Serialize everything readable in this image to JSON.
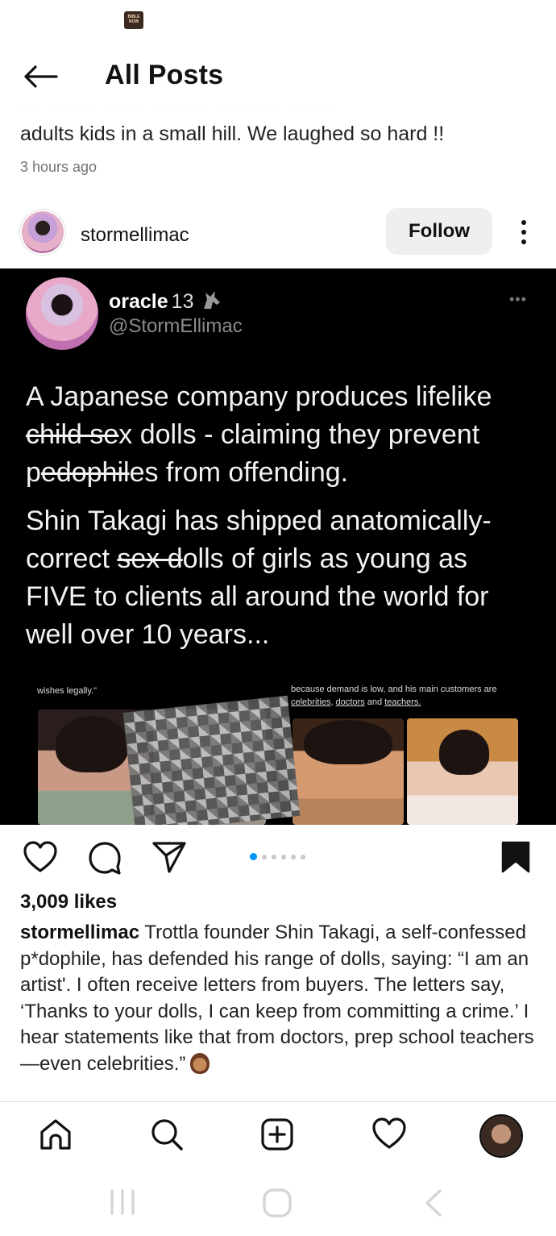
{
  "status_bar": {
    "app_icon_text": "BIBLE NOW"
  },
  "header": {
    "title": "All Posts"
  },
  "previous_post": {
    "caption_tail": "adults kids in a small hill.  We laughed so hard !!",
    "time_ago": "3 hours ago"
  },
  "post": {
    "username": "stormellimac",
    "follow_label": "Follow",
    "embedded_tweet": {
      "display_name": "oracle",
      "name_suffix": "13",
      "handle": "@StormEllimac",
      "para1_a": "A Japanese company produces lifelike ",
      "para1_strike1": "child se",
      "para1_b": "x dolls - claiming they prevent ",
      "para1_c": "p",
      "para1_strike2": "edophil",
      "para1_d": "es from offending.",
      "para2_a": "Shin Takagi has shipped anatomically-correct ",
      "para2_strike": "sex d",
      "para2_b": "olls of girls as young as FIVE to clients all around the world for well over 10 years...",
      "image_caption_left": "wishes legally.\"",
      "image_caption_right_a": "because demand is low, and his main customers are ",
      "image_caption_right_u1": "celebrities",
      "image_caption_right_b": ", ",
      "image_caption_right_u2": "doctors",
      "image_caption_right_c": " and ",
      "image_caption_right_u3": "teachers."
    },
    "carousel": {
      "count": 6,
      "active_index": 0
    },
    "likes": "3,009 likes",
    "caption_user": "stormellimac",
    "caption_text": " Trottla founder Shin Takagi, a self-confessed p*dophile, has defended his range of dolls, saying: “I am an artist'. I often receive letters from buyers. The letters say, ‘Thanks to your dolls, I can keep from committing a crime.’ I hear statements like that from doctors, prep school teachers—even celebrities.”"
  },
  "icons": {
    "back": "arrow-left-icon",
    "more": "more-vertical-icon",
    "like": "heart-icon",
    "comment": "comment-icon",
    "share": "send-icon",
    "save": "bookmark-filled-icon",
    "home": "home-icon",
    "search": "search-icon",
    "create": "plus-square-icon",
    "activity": "heart-icon",
    "profile": "profile-avatar",
    "nav_recents": "recents-icon",
    "nav_home": "home-button-icon",
    "nav_back": "back-chevron-icon"
  },
  "colors": {
    "accent": "#0095f6",
    "media_bg": "#000000",
    "follow_bg": "#efefef"
  }
}
